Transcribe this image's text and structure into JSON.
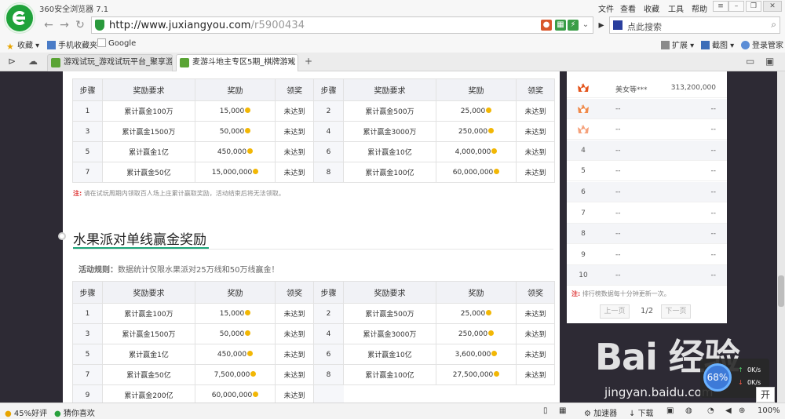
{
  "browser": {
    "title": "360安全浏览器 7.1",
    "menu": [
      "文件",
      "查看",
      "收藏",
      "工具",
      "帮助"
    ],
    "url_host": "http://www.juxiangyou.com",
    "url_path": "/r5900434",
    "search_placeholder": "点此搜索",
    "extensions_label": "扩展",
    "screenshot_label": "截图",
    "login_label": "登录管家"
  },
  "bookmarks": [
    {
      "label": "收藏",
      "icon": "star-icon"
    },
    {
      "label": "手机收藏夹",
      "icon": "phone-icon"
    },
    {
      "label": "Google",
      "icon": "google-icon"
    }
  ],
  "tabs": [
    {
      "title": "游戏试玩_游戏试玩平台_聚享游",
      "active": false
    },
    {
      "title": "麦游斗地主专区5期_棋牌游戏",
      "active": true
    }
  ],
  "page": {
    "table_headers": [
      "步骤",
      "奖励要求",
      "奖励",
      "领奖",
      "步骤",
      "奖励要求",
      "奖励",
      "领奖"
    ],
    "table1": [
      {
        "step_a": "1",
        "req_a": "累计赢金100万",
        "reward_a": "15,000",
        "status_a": "未达到",
        "step_b": "2",
        "req_b": "累计赢金500万",
        "reward_b": "25,000",
        "status_b": "未达到"
      },
      {
        "step_a": "3",
        "req_a": "累计赢金1500万",
        "reward_a": "50,000",
        "status_a": "未达到",
        "step_b": "4",
        "req_b": "累计赢金3000万",
        "reward_b": "250,000",
        "status_b": "未达到"
      },
      {
        "step_a": "5",
        "req_a": "累计赢金1亿",
        "reward_a": "450,000",
        "status_a": "未达到",
        "step_b": "6",
        "req_b": "累计赢金10亿",
        "reward_b": "4,000,000",
        "status_b": "未达到"
      },
      {
        "step_a": "7",
        "req_a": "累计赢金50亿",
        "reward_a": "15,000,000",
        "status_a": "未达到",
        "step_b": "8",
        "req_b": "累计赢金100亿",
        "reward_b": "60,000,000",
        "status_b": "未达到"
      }
    ],
    "note1_prefix": "注:",
    "note1": "请在试玩周期内领取百人场上庄累计赢取奖励，活动结束后将无法领取。",
    "section2_title": "水果派对单线赢金奖励",
    "rules_prefix": "活动规则：",
    "rules": "数据统计仅限水果派对25万线和50万线赢金！",
    "table2": [
      {
        "step_a": "1",
        "req_a": "累计赢金100万",
        "reward_a": "15,000",
        "status_a": "未达到",
        "step_b": "2",
        "req_b": "累计赢金500万",
        "reward_b": "25,000",
        "status_b": "未达到"
      },
      {
        "step_a": "3",
        "req_a": "累计赢金1500万",
        "reward_a": "50,000",
        "status_a": "未达到",
        "step_b": "4",
        "req_b": "累计赢金3000万",
        "reward_b": "250,000",
        "status_b": "未达到"
      },
      {
        "step_a": "5",
        "req_a": "累计赢金1亿",
        "reward_a": "450,000",
        "status_a": "未达到",
        "step_b": "6",
        "req_b": "累计赢金10亿",
        "reward_b": "3,600,000",
        "status_b": "未达到"
      },
      {
        "step_a": "7",
        "req_a": "累计赢金50亿",
        "reward_a": "7,500,000",
        "status_a": "未达到",
        "step_b": "8",
        "req_b": "累计赢金100亿",
        "reward_b": "27,500,000",
        "status_b": "未达到"
      },
      {
        "step_a": "9",
        "req_a": "累计赢金200亿",
        "reward_a": "60,000,000",
        "status_a": "未达到"
      }
    ]
  },
  "ranking": {
    "rows": [
      {
        "rank": "1",
        "crown": "gold",
        "name": "美女等***",
        "score": "313,200,000"
      },
      {
        "rank": "2",
        "crown": "silver",
        "name": "--",
        "score": "--"
      },
      {
        "rank": "3",
        "crown": "bronze",
        "name": "--",
        "score": "--"
      },
      {
        "rank": "4",
        "name": "--",
        "score": "--"
      },
      {
        "rank": "5",
        "name": "--",
        "score": "--"
      },
      {
        "rank": "6",
        "name": "--",
        "score": "--"
      },
      {
        "rank": "7",
        "name": "--",
        "score": "--"
      },
      {
        "rank": "8",
        "name": "--",
        "score": "--"
      },
      {
        "rank": "9",
        "name": "--",
        "score": "--"
      },
      {
        "rank": "10",
        "name": "--",
        "score": "--"
      }
    ],
    "note_prefix": "注:",
    "note": "排行榜数据每十分钟更新一次。",
    "prev_label": "上一页",
    "next_label": "下一页",
    "page_info": "1/2"
  },
  "watermark": {
    "logo": "Bai 经验",
    "sub": "jingyan.baidu.com"
  },
  "speed": {
    "percent": "68%",
    "up": "0K/s",
    "down": "0K/s",
    "kai": "开"
  },
  "status": {
    "rating": "45%好评",
    "guess": "猜你喜欢",
    "accelerator": "加速器",
    "download": "下载",
    "zoom": "100%"
  },
  "colors": {
    "accent_green": "#1da57a",
    "reward_orange": "#e5820b",
    "page_bg": "#2d2a34"
  }
}
